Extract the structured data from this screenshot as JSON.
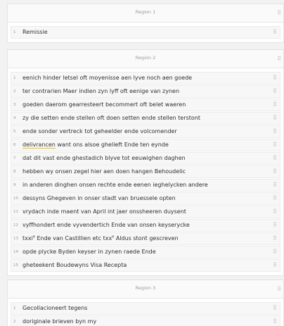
{
  "regions": [
    {
      "title": "Region 1",
      "lines": [
        {
          "n": "1",
          "text": "Remissie"
        }
      ]
    },
    {
      "title": "Region 2",
      "lines": [
        {
          "n": "1",
          "text": "eenich hinder letsel oft moyenisse aen lyve noch aen goede"
        },
        {
          "n": "2",
          "text": "ter contrarien Maer indien zyn lyff oft eenige van zynen"
        },
        {
          "n": "3",
          "text": "goeden daerom gearresteert becommert oft belet waeren"
        },
        {
          "n": "4",
          "text": "zy die setten ende stellen oft doen setten ende stellen terstont"
        },
        {
          "n": "5",
          "text": "ende sonder vertreck tot geheelder ende volcomender"
        },
        {
          "n": "6",
          "text_underlined": "delivrancen",
          "text_rest": " want ons alsoe ghelieft Ende ten eynde"
        },
        {
          "n": "7",
          "text": "dat dit vast ende ghestadich blyve tot eeuwighen daghen"
        },
        {
          "n": "8",
          "text": "hebben wy onsen zegel hier aen doen hangen Behoudelic"
        },
        {
          "n": "9",
          "text": "in anderen dinghen onsen rechte ende eenen ieghelycken andere"
        },
        {
          "n": "10",
          "text": "dessyns Ghegeven in onser stadt van bruessele opten"
        },
        {
          "n": "11",
          "text": "vrydach inde maent van April int jaer onssheeren duysent"
        },
        {
          "n": "12",
          "text": "vyffhondert ende vyvendertich Ende van onsen keyserycke"
        },
        {
          "n": "13",
          "text_a": "txxi",
          "sup_a": "e",
          "text_b": " Ende van Castillien etc txx",
          "sup_b": "e",
          "text_c": " Aldus stont gescreven"
        },
        {
          "n": "14",
          "text": "opde plycke Byden keyser in zynen raede Ende"
        },
        {
          "n": "15",
          "text": "gheteekent Boudewyns Visa Recepta"
        }
      ]
    },
    {
      "title": "Region 3",
      "lines": [
        {
          "n": "1",
          "text": "Gecollacioneert tegens"
        },
        {
          "n": "2",
          "text": "doriginale brieven byn my"
        }
      ]
    }
  ],
  "icons": {
    "drag_handle": "drag-handle-icon"
  },
  "colors": {
    "highlight_underline": "#f1c10f"
  }
}
